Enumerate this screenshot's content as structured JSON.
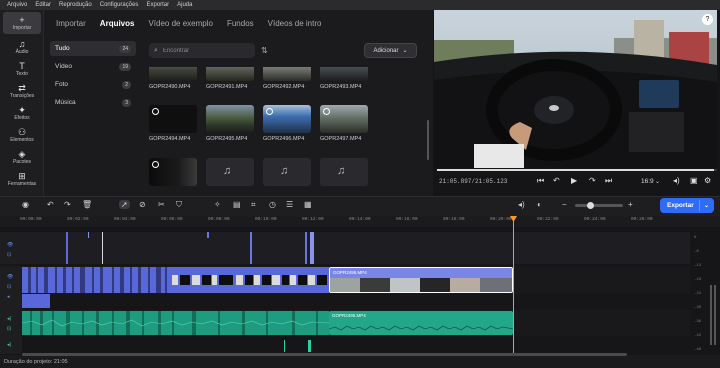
{
  "menu": [
    "Arquivo",
    "Editar",
    "Reprodução",
    "Configurações",
    "Exportar",
    "Ajuda"
  ],
  "rail": [
    {
      "icon": "plus-icon",
      "glyph": "+",
      "label": "Importar"
    },
    {
      "icon": "audio-icon",
      "glyph": "♫",
      "label": "Áudio"
    },
    {
      "icon": "text-icon",
      "glyph": "T",
      "label": "Texto"
    },
    {
      "icon": "transitions-icon",
      "glyph": "⇄",
      "label": "Transições"
    },
    {
      "icon": "effects-icon",
      "glyph": "✦",
      "label": "Efeitos"
    },
    {
      "icon": "elements-icon",
      "glyph": "⚇",
      "label": "Elementos"
    },
    {
      "icon": "stickers-icon",
      "glyph": "◈",
      "label": "Pacotes"
    },
    {
      "icon": "tools-icon",
      "glyph": "⊞",
      "label": "Ferramentas"
    }
  ],
  "media_tabs": [
    "Importar",
    "Arquivos",
    "Vídeo de exemplo",
    "Fundos",
    "Vídeos de intro"
  ],
  "active_tab": "Arquivos",
  "categories": [
    {
      "label": "Tudo",
      "count": "24"
    },
    {
      "label": "Vídeo",
      "count": "19"
    },
    {
      "label": "Foto",
      "count": "2"
    },
    {
      "label": "Música",
      "count": "3"
    }
  ],
  "search": {
    "placeholder": "Encontrar"
  },
  "add_button": "Adicionar",
  "files": [
    {
      "name": "GOPR2490.MP4",
      "kind": "video"
    },
    {
      "name": "GOPR2491.MP4",
      "kind": "video"
    },
    {
      "name": "GOPR2492.MP4",
      "kind": "video"
    },
    {
      "name": "GOPR2493.MP4",
      "kind": "video"
    },
    {
      "name": "GOPR2494.MP4",
      "kind": "video"
    },
    {
      "name": "GOPR2495.MP4",
      "kind": "video"
    },
    {
      "name": "GOPR2496.MP4",
      "kind": "video"
    },
    {
      "name": "GOPR2497.MP4",
      "kind": "video"
    },
    {
      "name": "",
      "kind": "video"
    },
    {
      "name": "",
      "kind": "audio"
    },
    {
      "name": "",
      "kind": "audio"
    },
    {
      "name": "",
      "kind": "audio"
    }
  ],
  "preview": {
    "timecode": "21:05.897/21:05.123",
    "ratio": "16:9",
    "progress": 0.99
  },
  "export_button": "Exportar",
  "ruler": [
    "00:00:00",
    "00:02:00",
    "00:04:00",
    "00:06:00",
    "00:08:00",
    "00:10:00",
    "00:12:00",
    "00:14:00",
    "00:16:00",
    "00:18:00",
    "00:20:00",
    "00:22:00",
    "00:24:00",
    "00:26:00"
  ],
  "clips": {
    "video_label": "GOPR2495.MP4",
    "audio_label": "GOPR2495.MP4"
  },
  "status": "Duração do projeto: 21:05",
  "colors": {
    "accent": "#2f6cf6",
    "video_clip": "#5868d8",
    "audio_clip": "#1e9c80",
    "playhead": "#f59a2a"
  }
}
